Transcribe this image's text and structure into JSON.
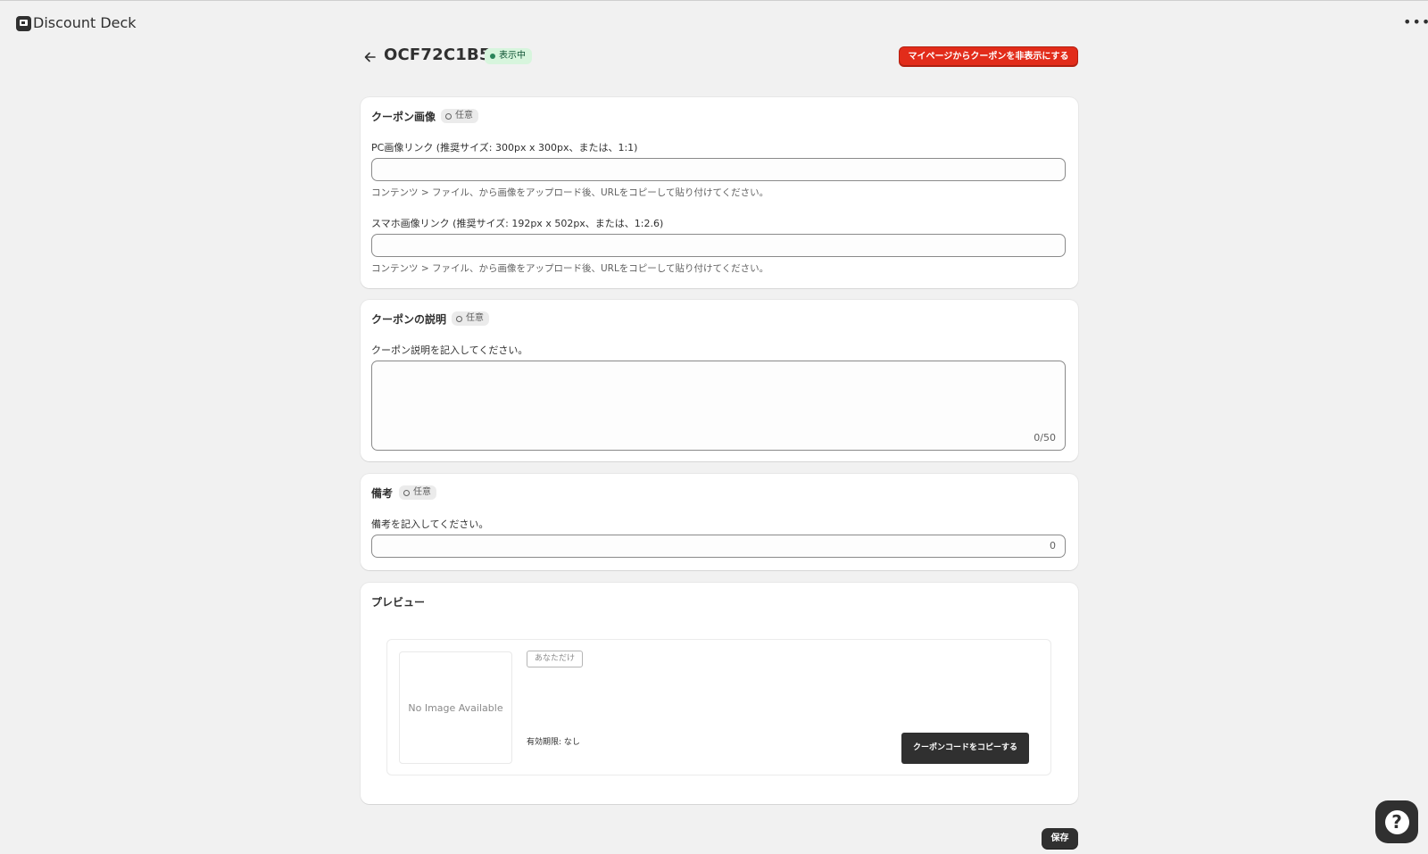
{
  "app": {
    "title": "Discount Deck",
    "more_icon": "more-horizontal-icon",
    "logo_icon": "app-logo-icon"
  },
  "header": {
    "title": "OCF72C1B56",
    "status": "表示中",
    "hide_button": "マイページからクーポンを非表示にする"
  },
  "sections": {
    "image": {
      "heading": "クーポン画像",
      "optional": "任意",
      "pc_label": "PC画像リンク (推奨サイズ: 300px x 300px、または、1:1)",
      "pc_value": "",
      "pc_help": "コンテンツ > ファイル、から画像をアップロード後、URLをコピーして貼り付けてください。",
      "sp_label": "スマホ画像リンク (推奨サイズ: 192px x 502px、または、1:2.6)",
      "sp_value": "",
      "sp_help": "コンテンツ > ファイル、から画像をアップロード後、URLをコピーして貼り付けてください。"
    },
    "description": {
      "heading": "クーポンの説明",
      "optional": "任意",
      "label": "クーポン説明を記入してください。",
      "value": "",
      "count": "0/50"
    },
    "notes": {
      "heading": "備考",
      "optional": "任意",
      "label": "備考を記入してください。",
      "value": "",
      "count": "0"
    },
    "preview": {
      "heading": "プレビュー",
      "no_image": "No Image Available",
      "audience_tag": "あなただけ",
      "expiry": "有効期限: なし",
      "copy_button": "クーポンコードをコピーする"
    }
  },
  "footer": {
    "save_button": "保存"
  },
  "colors": {
    "accent_red": "#e22c1a",
    "success_bg": "#d7f5dd",
    "dark": "#303030",
    "page_bg": "#f1f1f1"
  }
}
